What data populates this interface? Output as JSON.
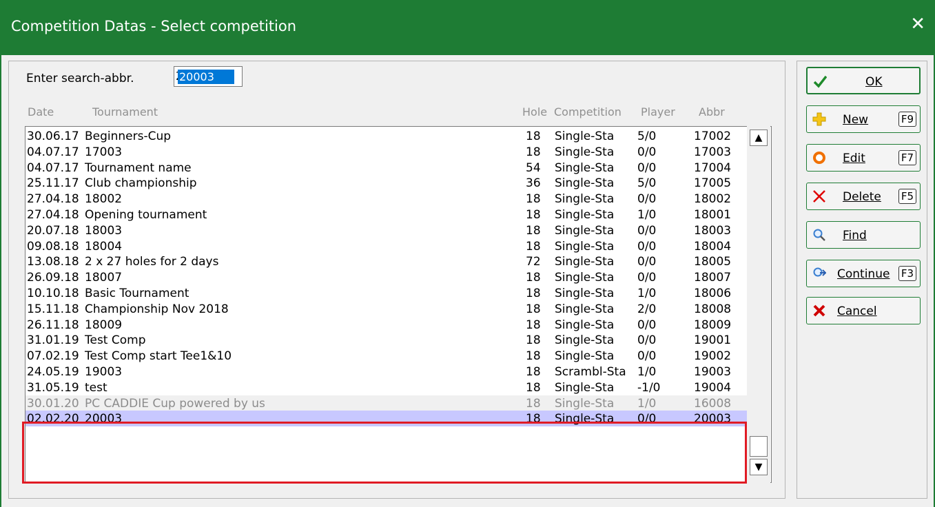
{
  "window": {
    "title": "Competition Datas - Select competition",
    "close_label": "✕"
  },
  "search": {
    "label": "Enter search-abbr.",
    "value": "20003"
  },
  "columns": {
    "date": "Date",
    "tournament": "Tournament",
    "hole": "Hole",
    "competition": "Competition",
    "player": "Player",
    "abbr": "Abbr"
  },
  "rows": [
    {
      "date": "30.06.17",
      "tournament": "Beginners-Cup",
      "hole": "18",
      "competition": "Single-Sta",
      "player": "5/0",
      "abbr": "17002"
    },
    {
      "date": "04.07.17",
      "tournament": "17003",
      "hole": "18",
      "competition": "Single-Sta",
      "player": "0/0",
      "abbr": "17003"
    },
    {
      "date": "04.07.17",
      "tournament": "Tournament name",
      "hole": "54",
      "competition": "Single-Sta",
      "player": "0/0",
      "abbr": "17004"
    },
    {
      "date": "25.11.17",
      "tournament": "Club championship",
      "hole": "36",
      "competition": "Single-Sta",
      "player": "5/0",
      "abbr": "17005"
    },
    {
      "date": "27.04.18",
      "tournament": "18002",
      "hole": "18",
      "competition": "Single-Sta",
      "player": "0/0",
      "abbr": "18002"
    },
    {
      "date": "27.04.18",
      "tournament": "Opening tournament",
      "hole": "18",
      "competition": "Single-Sta",
      "player": "1/0",
      "abbr": "18001"
    },
    {
      "date": "20.07.18",
      "tournament": "18003",
      "hole": "18",
      "competition": "Single-Sta",
      "player": "0/0",
      "abbr": "18003"
    },
    {
      "date": "09.08.18",
      "tournament": "18004",
      "hole": "18",
      "competition": "Single-Sta",
      "player": "0/0",
      "abbr": "18004"
    },
    {
      "date": "13.08.18",
      "tournament": "2 x 27 holes for 2 days",
      "hole": "72",
      "competition": "Single-Sta",
      "player": "0/0",
      "abbr": "18005"
    },
    {
      "date": "26.09.18",
      "tournament": "18007",
      "hole": "18",
      "competition": "Single-Sta",
      "player": "0/0",
      "abbr": "18007"
    },
    {
      "date": "10.10.18",
      "tournament": "Basic Tournament",
      "hole": "18",
      "competition": "Single-Sta",
      "player": "1/0",
      "abbr": "18006"
    },
    {
      "date": "15.11.18",
      "tournament": "Championship Nov 2018",
      "hole": "18",
      "competition": "Single-Sta",
      "player": "2/0",
      "abbr": "18008"
    },
    {
      "date": "26.11.18",
      "tournament": "18009",
      "hole": "18",
      "competition": "Single-Sta",
      "player": "0/0",
      "abbr": "18009"
    },
    {
      "date": "31.01.19",
      "tournament": "Test Comp",
      "hole": "18",
      "competition": "Single-Sta",
      "player": "0/0",
      "abbr": "19001"
    },
    {
      "date": "07.02.19",
      "tournament": "Test Comp start Tee1&10",
      "hole": "18",
      "competition": "Single-Sta",
      "player": "0/0",
      "abbr": "19002"
    },
    {
      "date": "24.05.19",
      "tournament": "19003",
      "hole": "18",
      "competition": "Scrambl-Sta",
      "player": "1/0",
      "abbr": "19003"
    },
    {
      "date": "31.05.19",
      "tournament": "test",
      "hole": "18",
      "competition": "Single-Sta",
      "player": "-1/0",
      "abbr": "19004"
    },
    {
      "date": "30.01.20",
      "tournament": "PC CADDIE Cup  powered by us",
      "hole": "18",
      "competition": "Single-Sta",
      "player": "1/0",
      "abbr": "16008",
      "state": "gray"
    },
    {
      "date": "02.02.20",
      "tournament": "20003",
      "hole": "18",
      "competition": "Single-Sta",
      "player": "0/0",
      "abbr": "20003",
      "state": "selected"
    }
  ],
  "scrollbar": {
    "up_arrow": "▲",
    "down_arrow": "▼"
  },
  "buttons": {
    "ok": {
      "label": "OK"
    },
    "new": {
      "label": "New",
      "key": "F9"
    },
    "edit": {
      "label": "Edit",
      "key": "F7"
    },
    "delete": {
      "label": "Delete",
      "key": "F5"
    },
    "find": {
      "label": "Find"
    },
    "continue": {
      "label": "Continue",
      "key": "F3"
    },
    "cancel": {
      "label": "Cancel"
    }
  },
  "colors": {
    "titlebar": "#1e7c34",
    "selected_row": "#c8c8ff",
    "highlight_box": "#e01b24"
  }
}
